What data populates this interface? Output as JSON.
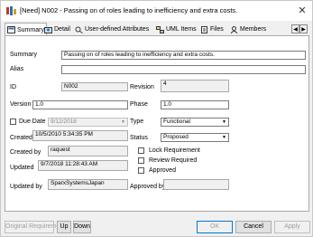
{
  "window": {
    "title": "[Need] N002 - Passing on of roles leading to inefficiency and extra costs.",
    "close_glyph": "✕"
  },
  "tabs": [
    {
      "label": "Summary",
      "icon": "summary-icon"
    },
    {
      "label": "Detail",
      "icon": "detail-icon"
    },
    {
      "label": "User-defined Attributes",
      "icon": "attributes-icon"
    },
    {
      "label": "UML Items",
      "icon": "uml-items-icon"
    },
    {
      "label": "Files",
      "icon": "files-icon"
    },
    {
      "label": "Members",
      "icon": "members-icon"
    }
  ],
  "tab_scroll": {
    "left": "◀",
    "right": "▶"
  },
  "form": {
    "summary_label": "Summary",
    "summary_value": "Passing on of roles leading to inefficiency and extra costs.",
    "alias_label": "Alias",
    "alias_value": "",
    "id_label": "ID",
    "id_value": "N002",
    "revision_label": "Revision",
    "revision_value": "4",
    "version_label": "Version",
    "version_value": "1.0",
    "phase_label": "Phase",
    "phase_value": "1.0",
    "due_date_label": "Due Date",
    "due_date_value": "9/12/2018",
    "due_date_checked": false,
    "type_label": "Type",
    "type_value": "Functional",
    "created_label": "Created",
    "created_value": "10/5/2010 5:34:35 PM",
    "status_label": "Status",
    "status_value": "Proposed",
    "created_by_label": "Created by",
    "created_by_value": "raquest",
    "lock_label": "Lock Requirement",
    "review_label": "Review Required",
    "approved_label": "Approved",
    "updated_label": "Updated",
    "updated_value": "9/7/2018 11:28:43 AM",
    "updated_by_label": "Updated by",
    "updated_by_value": "SparxSystemsJapan",
    "approved_by_label": "Approved by",
    "approved_by_value": "",
    "dropdown_glyph": "▼"
  },
  "buttons": {
    "original": "Original Requirement",
    "up": "Up",
    "down": "Down",
    "ok": "OK",
    "cancel": "Cancel",
    "apply": "Apply"
  }
}
